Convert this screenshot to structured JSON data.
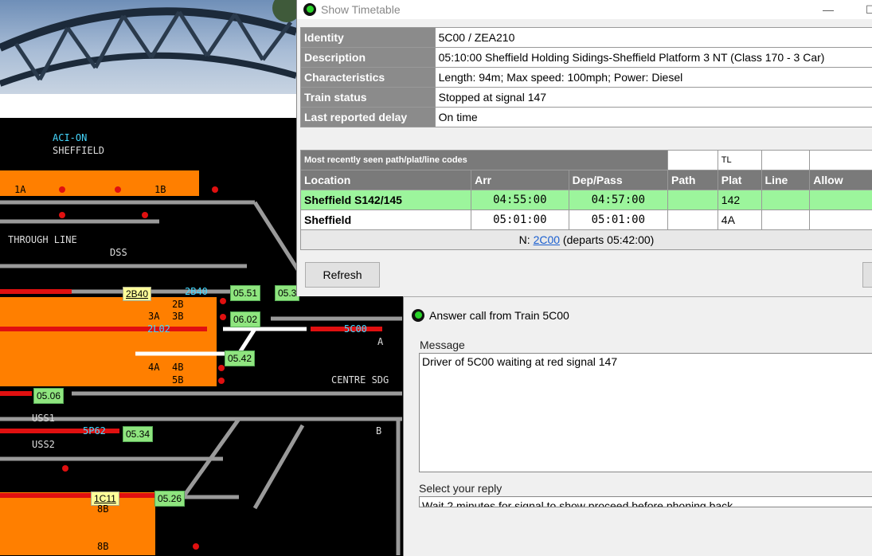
{
  "timetable": {
    "title": "Show Timetable",
    "info": [
      {
        "key": "Identity",
        "value": "5C00 / ZEA210"
      },
      {
        "key": "Description",
        "value": "05:10:00 Sheffield Holding Sidings-Sheffield Platform 3 NT (Class 170 - 3 Car)"
      },
      {
        "key": "Characteristics",
        "value": "Length: 94m; Max speed: 100mph; Power: Diesel"
      },
      {
        "key": "Train status",
        "value": "Stopped at signal 147"
      },
      {
        "key": "Last reported delay",
        "value": "On time"
      }
    ],
    "codes_header": "Most recently seen path/plat/line codes",
    "codes_plat": "TL",
    "columns": [
      "Location",
      "Arr",
      "Dep/Pass",
      "Path",
      "Plat",
      "Line",
      "Allow"
    ],
    "rows": [
      {
        "location": "Sheffield S142/145",
        "arr": "04:55:00",
        "dep": "04:57:00",
        "path": "",
        "plat": "142",
        "line": "",
        "allow": ""
      },
      {
        "location": "Sheffield",
        "arr": "05:01:00",
        "dep": "05:01:00",
        "path": "",
        "plat": "4A",
        "line": "",
        "allow": ""
      }
    ],
    "next_prefix": "N:",
    "next_link": "2C00",
    "next_suffix": "(departs 05:42:00)",
    "refresh_label": "Refresh",
    "minimize": "—",
    "maximize": "☐"
  },
  "answer": {
    "title": "Answer call from Train 5C00",
    "message_label": "Message",
    "message": "Driver of 5C00 waiting at red signal 147",
    "reply_label": "Select your reply",
    "reply": "Wait 2 minutes for signal to show proceed before phoning back"
  },
  "diagram": {
    "aci": "ACI-ON",
    "area": "SHEFFIELD",
    "labels": {
      "p1a": "1A",
      "p1b": "1B",
      "through": "THROUGH LINE",
      "dss": "DSS",
      "p2b": "2B",
      "p3a": "3A",
      "p3b": "3B",
      "p4a": "4A",
      "p4b": "4B",
      "p5b": "5B",
      "centre": "CENTRE SDG",
      "a": "A",
      "b": "B",
      "uss1": "USS1",
      "uss2": "USS2",
      "p8b": "8B",
      "p8b2": "8B"
    },
    "berths": {
      "b2b40": "2B40",
      "b2l02": "2L02",
      "b5c00": "5C00",
      "b5p62": "5P62"
    },
    "highlight": {
      "y2b40": "2B40",
      "y1c11": "1C11"
    },
    "times": {
      "t0551": "05.51",
      "t053x": "05.3",
      "t0602": "06.02",
      "t0542": "05.42",
      "t0506": "05.06",
      "t0534": "05.34",
      "t0526": "05.26"
    },
    "colors": {
      "platform": "#ff7f00",
      "track": "#9a9a9a",
      "occupied": "#e01010",
      "route": "#ffffff",
      "berth": "#45d8ff"
    }
  }
}
